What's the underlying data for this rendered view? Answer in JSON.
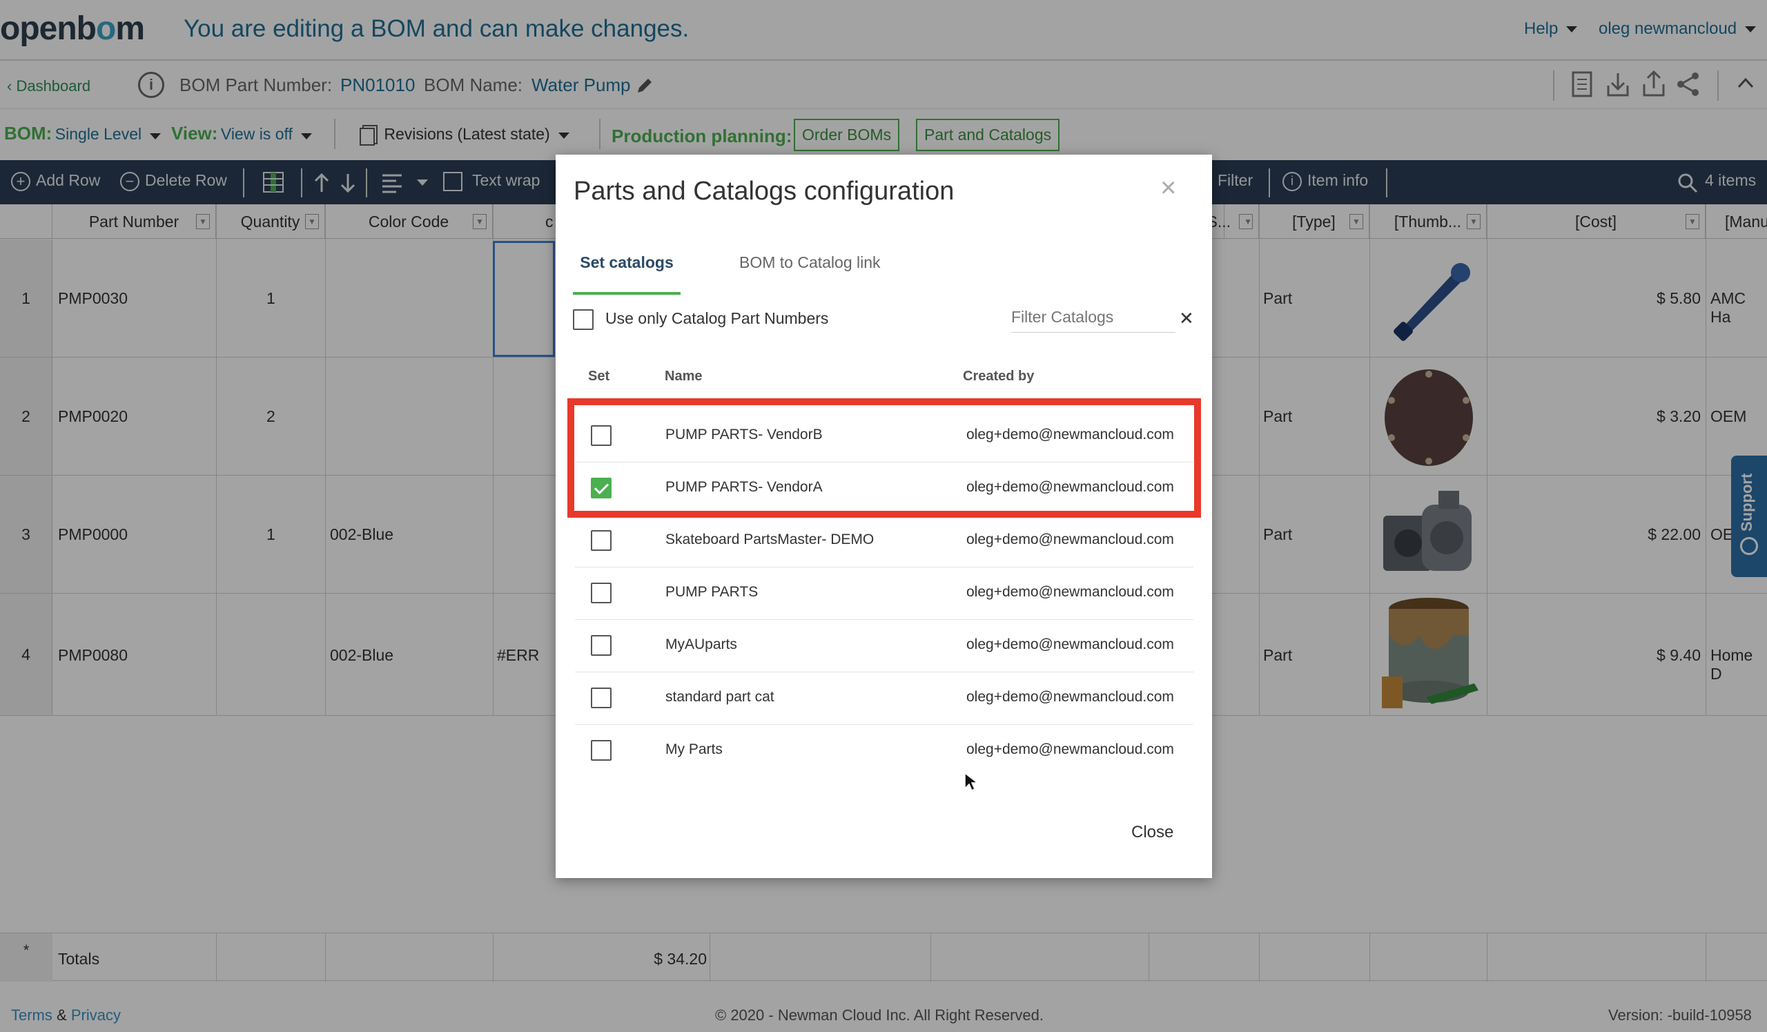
{
  "header": {
    "logo": "openbom",
    "edit_message": "You are editing a BOM and can make changes.",
    "help": "Help",
    "user": "oleg newmancloud"
  },
  "crumbs": {
    "dashboard": "Dashboard",
    "bom_part_number_label": "BOM Part Number:",
    "bom_part_number": "PN01010",
    "bom_name_label": "BOM Name:",
    "bom_name": "Water Pump"
  },
  "bombar": {
    "bom_label": "BOM:",
    "bom_value": "Single Level",
    "view_label": "View:",
    "view_value": "View is off",
    "revisions": "Revisions (Latest state)",
    "production_label": "Production planning:",
    "order_boms": "Order BOMs",
    "part_catalogs": "Part and Catalogs"
  },
  "actions": {
    "add_row": "Add Row",
    "delete_row": "Delete Row",
    "text_wrap": "Text wrap",
    "filter": "Filter",
    "item_info": "Item info",
    "items_count": "4 items"
  },
  "grid": {
    "columns": [
      "Part Number",
      "Quantity",
      "Color Code",
      "c",
      "S...",
      "[Type]",
      "[Thumb...",
      "[Cost]",
      "[Manu"
    ],
    "rows": [
      {
        "num": "1",
        "part": "PMP0030",
        "qty": "1",
        "color": "",
        "c": "",
        "type": "Part",
        "cost": "$ 5.80",
        "manu": "AMC Ha"
      },
      {
        "num": "2",
        "part": "PMP0020",
        "qty": "2",
        "color": "",
        "c": "",
        "type": "Part",
        "cost": "$ 3.20",
        "manu": "OEM"
      },
      {
        "num": "3",
        "part": "PMP0000",
        "qty": "1",
        "color": "002-Blue",
        "c": "",
        "type": "Part",
        "cost": "$ 22.00",
        "manu": "OE"
      },
      {
        "num": "4",
        "part": "PMP0080",
        "qty": "",
        "color": "002-Blue",
        "c": "#ERR",
        "type": "Part",
        "cost": "$ 9.40",
        "manu": "Home D"
      }
    ],
    "totals_star": "*",
    "totals_label": "Totals",
    "totals_value": "$ 34.20"
  },
  "footer": {
    "terms": "Terms",
    "amp": "&",
    "privacy": "Privacy",
    "copyright": "© 2020 - Newman Cloud Inc. All Right Reserved.",
    "version": "Version: -build-10958"
  },
  "support": "Support",
  "modal": {
    "title": "Parts and Catalogs configuration",
    "tabs": [
      "Set catalogs",
      "BOM to Catalog link"
    ],
    "use_only": "Use only Catalog Part Numbers",
    "filter_placeholder": "Filter Catalogs",
    "columns": [
      "Set",
      "Name",
      "Created by"
    ],
    "catalogs": [
      {
        "name": "PUMP PARTS- VendorB",
        "by": "oleg+demo@newmancloud.com",
        "checked": false
      },
      {
        "name": "PUMP PARTS- VendorA",
        "by": "oleg+demo@newmancloud.com",
        "checked": true
      },
      {
        "name": "Skateboard PartsMaster- DEMO",
        "by": "oleg+demo@newmancloud.com",
        "checked": false
      },
      {
        "name": "PUMP PARTS",
        "by": "oleg+demo@newmancloud.com",
        "checked": false
      },
      {
        "name": "MyAUparts",
        "by": "oleg+demo@newmancloud.com",
        "checked": false
      },
      {
        "name": "standard part cat",
        "by": "oleg+demo@newmancloud.com",
        "checked": false
      },
      {
        "name": "My Parts",
        "by": "oleg+demo@newmancloud.com",
        "checked": false
      }
    ],
    "close": "Close"
  }
}
